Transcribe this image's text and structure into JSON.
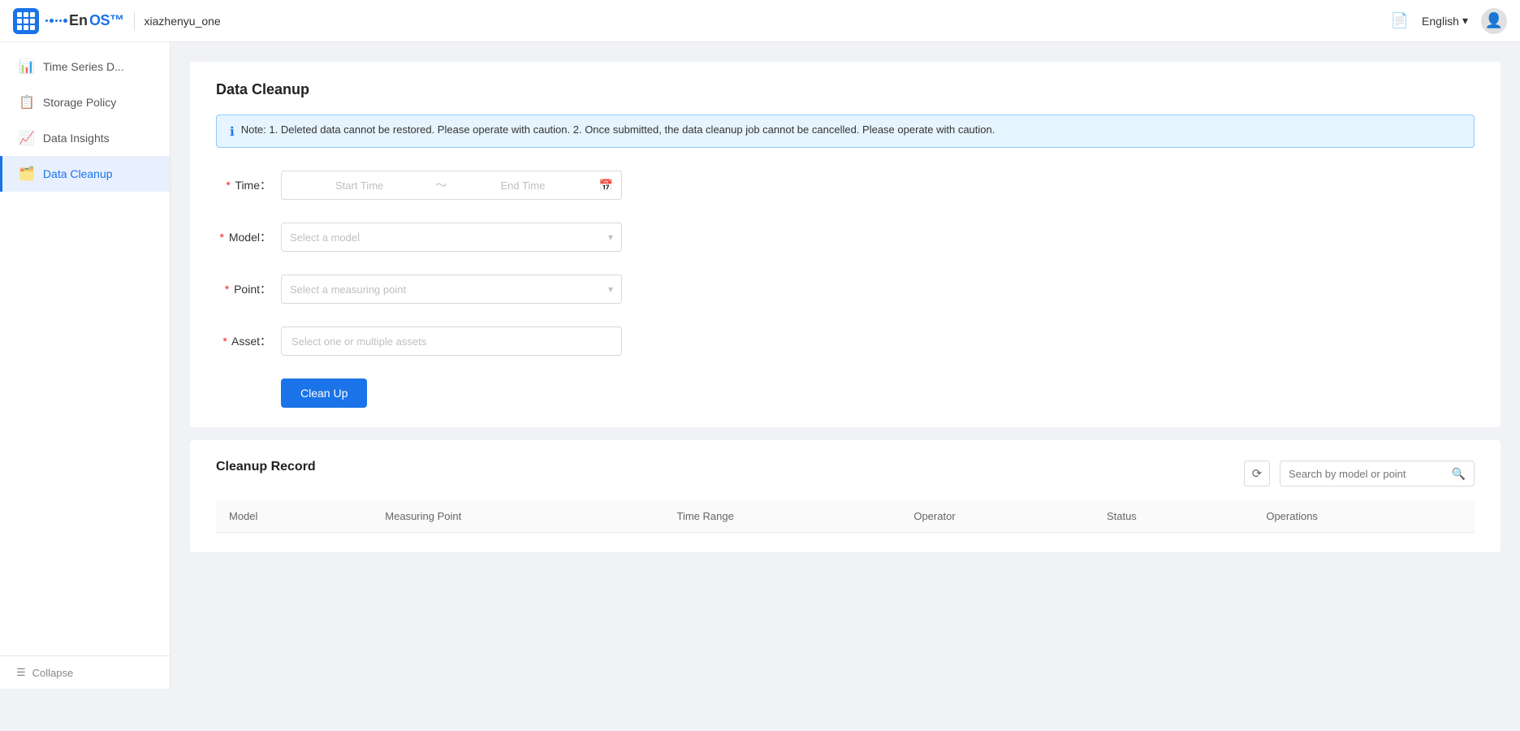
{
  "topbar": {
    "logo_alt": "EnOS",
    "en_text": "En",
    "os_text": "OS",
    "username": "xiazhenyu_one",
    "lang_label": "English",
    "doc_icon": "📄"
  },
  "sidebar": {
    "items": [
      {
        "id": "time-series",
        "label": "Time Series D...",
        "icon": "📊",
        "active": false
      },
      {
        "id": "storage-policy",
        "label": "Storage Policy",
        "icon": "📋",
        "active": false
      },
      {
        "id": "data-insights",
        "label": "Data Insights",
        "icon": "📈",
        "active": false
      },
      {
        "id": "data-cleanup",
        "label": "Data Cleanup",
        "icon": "🗂️",
        "active": true
      }
    ],
    "collapse_label": "Collapse",
    "collapse_icon": "☰"
  },
  "page": {
    "title": "Data Cleanup",
    "alert_text": "Note: 1. Deleted data cannot be restored. Please operate with caution. 2. Once submitted, the data cleanup job cannot be cancelled. Please operate with caution.",
    "form": {
      "time_label": "Time",
      "time_start_placeholder": "Start Time",
      "time_end_placeholder": "End Time",
      "model_label": "Model",
      "model_placeholder": "Select a model",
      "point_label": "Point",
      "point_placeholder": "Select a measuring point",
      "asset_label": "Asset",
      "asset_placeholder": "Select one or multiple assets"
    },
    "cleanup_button": "Clean Up",
    "record_section": {
      "title": "Cleanup Record",
      "search_placeholder": "Search by model or point",
      "refresh_icon": "⟳",
      "search_icon": "🔍",
      "table_headers": [
        "Model",
        "Measuring Point",
        "Time Range",
        "Operator",
        "Status",
        "Operations"
      ]
    }
  }
}
